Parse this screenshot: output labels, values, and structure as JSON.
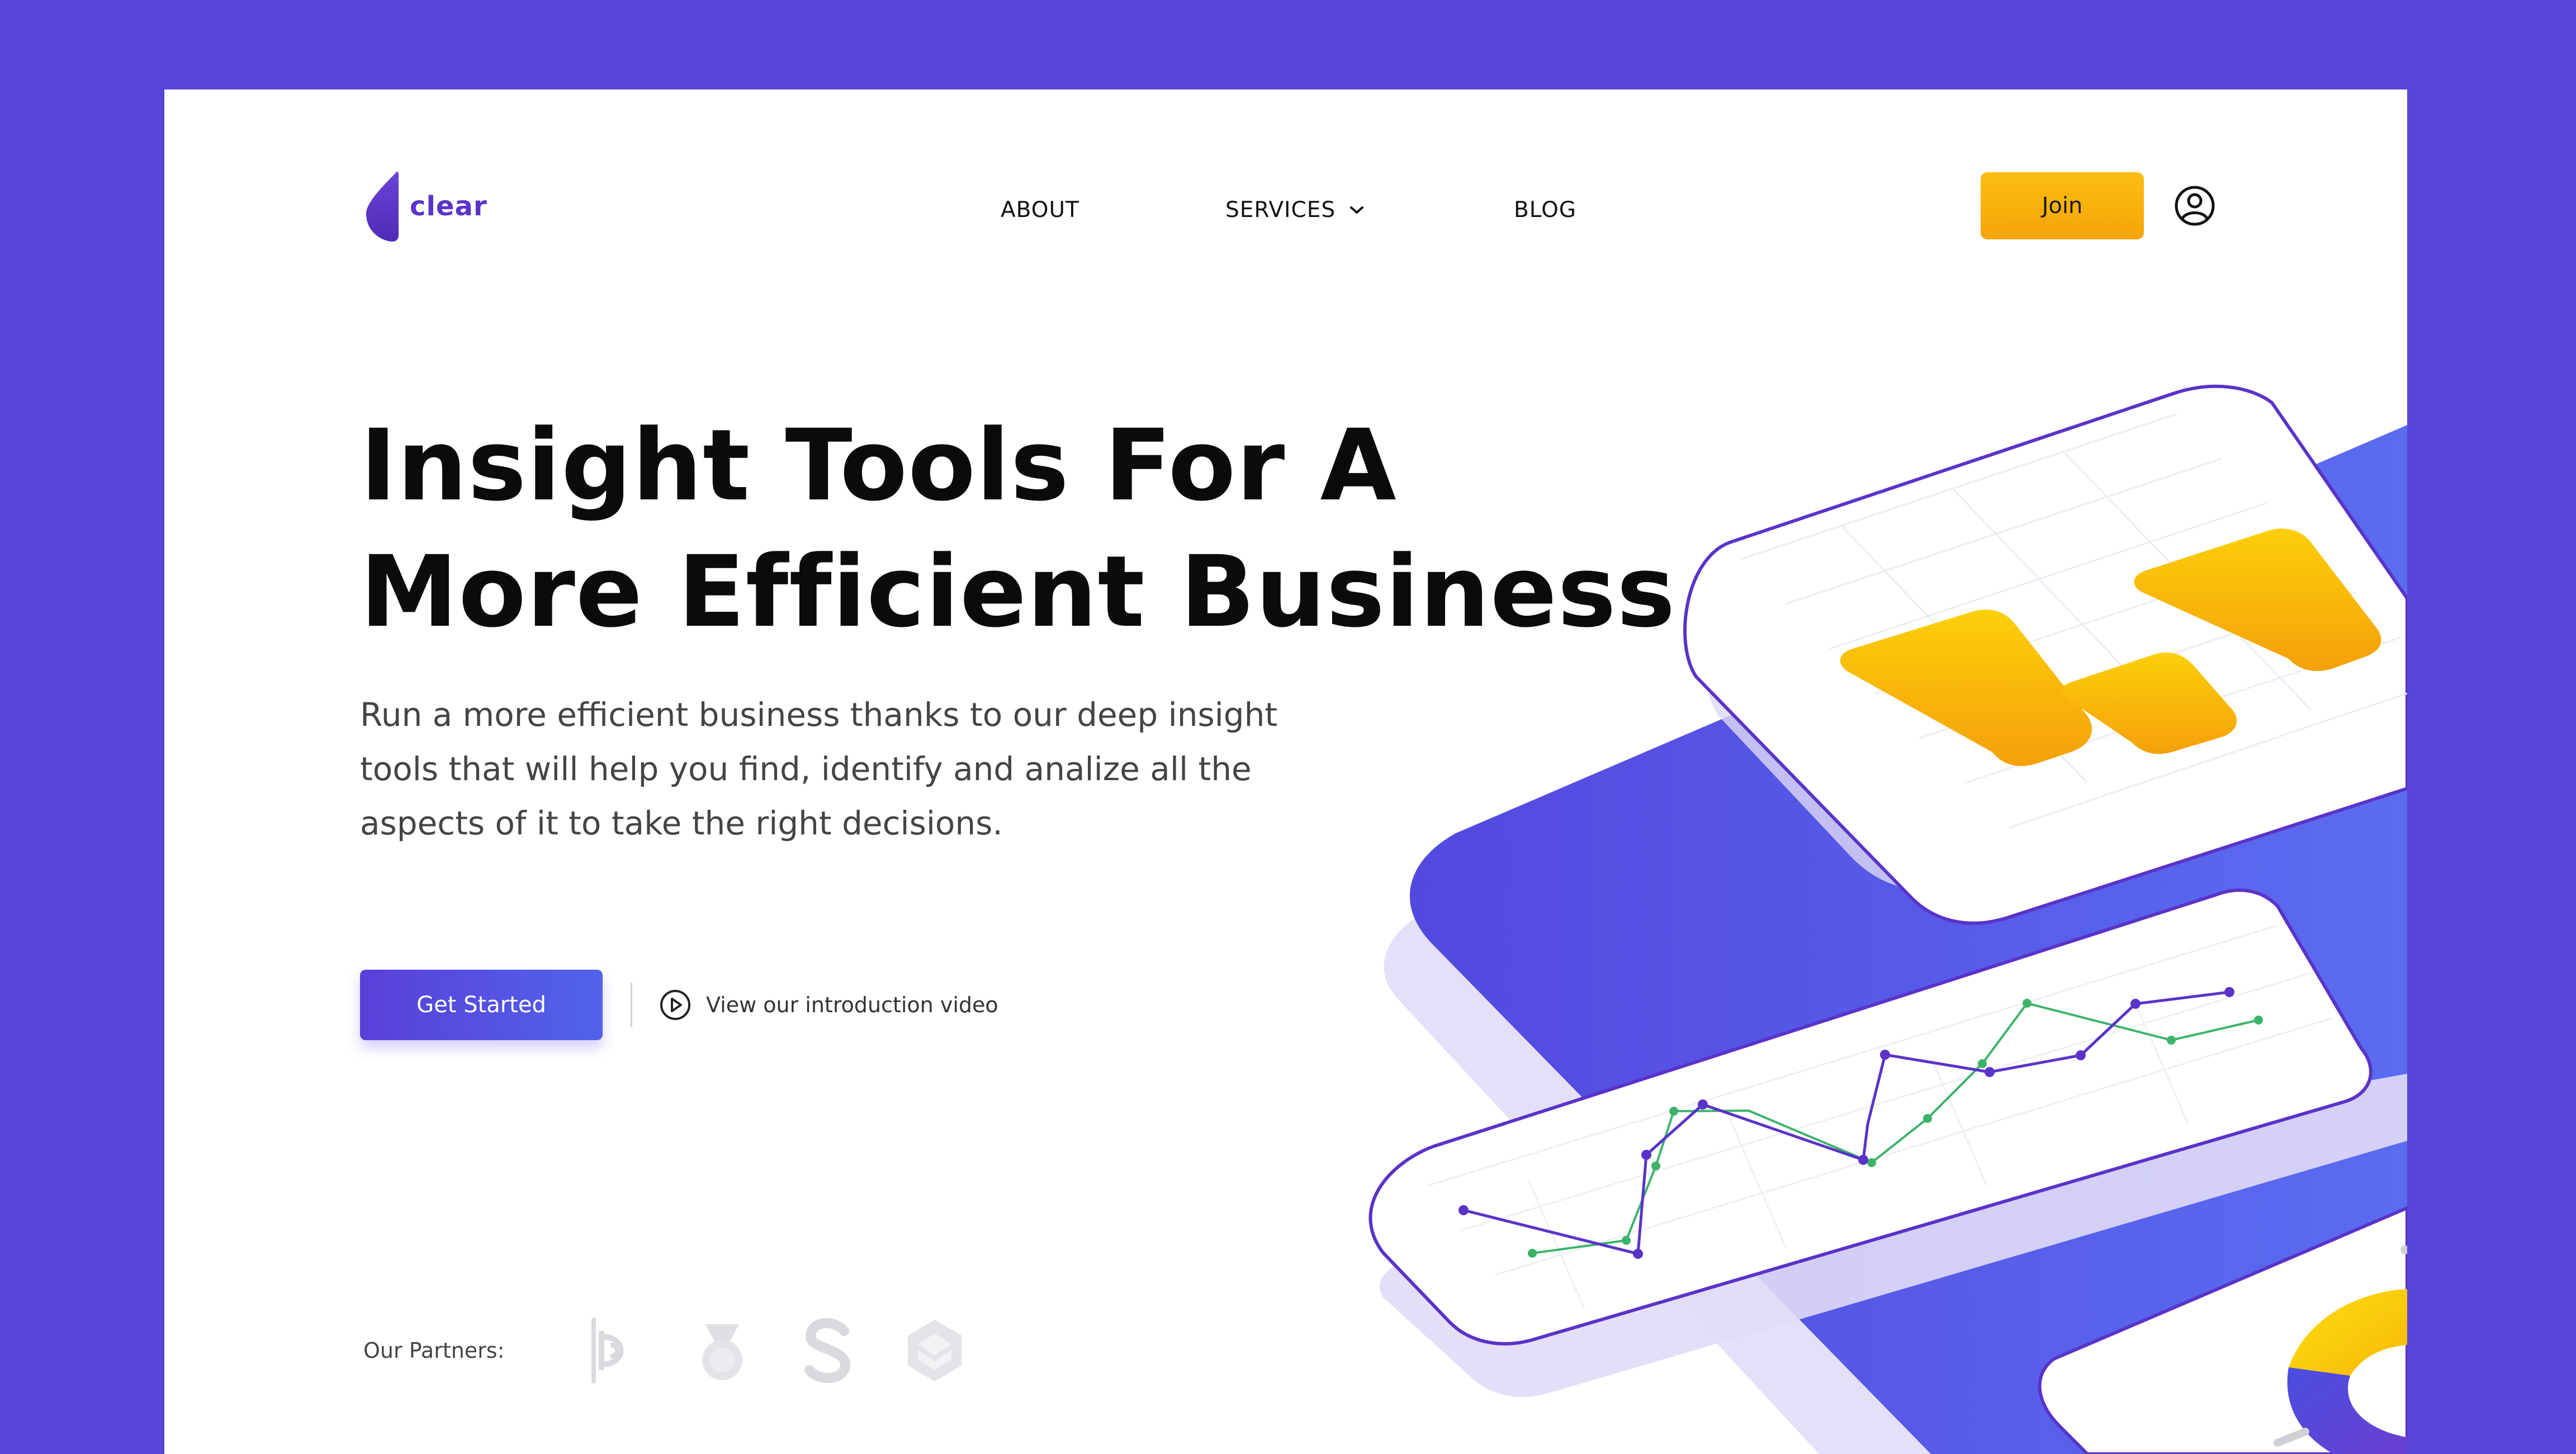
{
  "brand": {
    "name": "clear",
    "accent_color": "#5645d8",
    "logo_color": "#5a33c8",
    "cta_color": "#f5a507"
  },
  "nav": {
    "items": [
      {
        "label": "ABOUT"
      },
      {
        "label": "SERVICES",
        "has_dropdown": true,
        "icon": "chevron-down-icon"
      },
      {
        "label": "BLOG"
      }
    ],
    "join_label": "Join",
    "user_icon": "user-circle-icon"
  },
  "hero": {
    "title_line1": "Insight Tools For A",
    "title_line2": "More Efficient Business",
    "description": "Run a more efficient business thanks to our deep insight tools that will help you find, identify and analize all the aspects of it to take the right decisions.",
    "cta_label": "Get Started",
    "video_label": "View our introduction video",
    "video_icon": "play-circle-icon"
  },
  "partners": {
    "label": "Our Partners:",
    "logos": [
      "partner-logo-b-icon",
      "partner-logo-medal-icon",
      "partner-logo-s-icon",
      "partner-logo-cube-icon"
    ]
  },
  "illustration": {
    "bar_card": {
      "bars": [
        3,
        1,
        3
      ]
    },
    "line_card": {
      "purple_series": [
        0,
        1,
        7,
        9,
        2,
        14,
        13,
        14,
        13,
        19,
        19
      ],
      "green_series": [
        0,
        3,
        5,
        8,
        3,
        6,
        10,
        16,
        15,
        14,
        16
      ]
    },
    "donut_card": {
      "segments": [
        "#fdd20a",
        "#5645d8"
      ]
    }
  }
}
